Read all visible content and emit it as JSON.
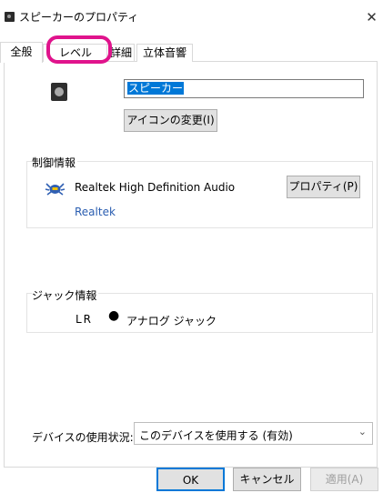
{
  "window": {
    "title": "スピーカーのプロパティ",
    "close_glyph": "✕"
  },
  "tabs": [
    {
      "label": "全般",
      "selected": true
    },
    {
      "label": "レベル",
      "selected": false
    },
    {
      "label": "詳細",
      "selected": false
    },
    {
      "label": "立体音響",
      "selected": false
    }
  ],
  "general": {
    "device_name": "スピーカー",
    "change_icon_label": "アイコンの変更(I)",
    "controller_info": {
      "section_label": "制御情報",
      "driver_name": "Realtek High Definition Audio",
      "properties_label": "プロパティ(P)",
      "vendor": "Realtek"
    },
    "jack_info": {
      "section_label": "ジャック情報",
      "channels": "LR",
      "bullet": "●",
      "jack_type": "アナログ ジャック"
    },
    "device_usage": {
      "label": "デバイスの使用状況:",
      "selected_value": "このデバイスを使用する (有効)",
      "chevron": "⌄"
    }
  },
  "footer": {
    "ok_label": "OK",
    "cancel_label": "キャンセル",
    "apply_label": "適用(A)"
  },
  "colors": {
    "selection": "#0078d7",
    "annotation_highlight": "#e0138c",
    "link": "#2a5db0"
  }
}
